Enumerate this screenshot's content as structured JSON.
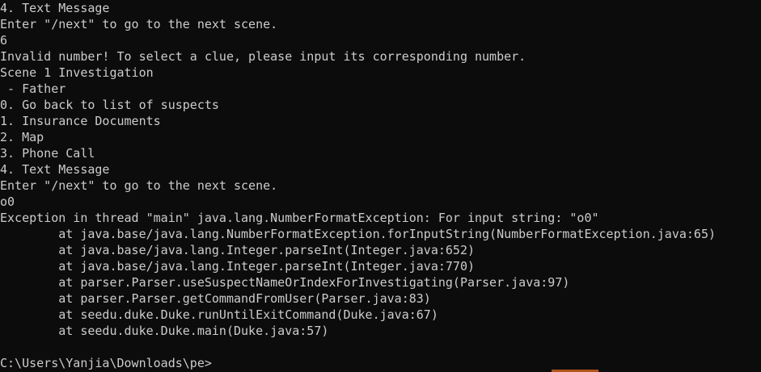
{
  "terminal": {
    "lines": [
      "4. Text Message",
      "Enter \"/next\" to go to the next scene.",
      "6",
      "Invalid number! To select a clue, please input its corresponding number.",
      "Scene 1 Investigation",
      " - Father",
      "0. Go back to list of suspects",
      "1. Insurance Documents",
      "2. Map",
      "3. Phone Call",
      "4. Text Message",
      "Enter \"/next\" to go to the next scene.",
      "o0",
      "Exception in thread \"main\" java.lang.NumberFormatException: For input string: \"o0\"",
      "        at java.base/java.lang.NumberFormatException.forInputString(NumberFormatException.java:65)",
      "        at java.base/java.lang.Integer.parseInt(Integer.java:652)",
      "        at java.base/java.lang.Integer.parseInt(Integer.java:770)",
      "        at parser.Parser.useSuspectNameOrIndexForInvestigating(Parser.java:97)",
      "        at parser.Parser.getCommandFromUser(Parser.java:83)",
      "        at seedu.duke.Duke.runUntilExitCommand(Duke.java:67)",
      "        at seedu.duke.Duke.main(Duke.java:57)",
      "",
      "C:\\Users\\Yanjia\\Downloads\\pe>"
    ]
  },
  "colors": {
    "background": "#0c0c0c",
    "foreground": "#cccccc",
    "accent": "#b3561a"
  }
}
